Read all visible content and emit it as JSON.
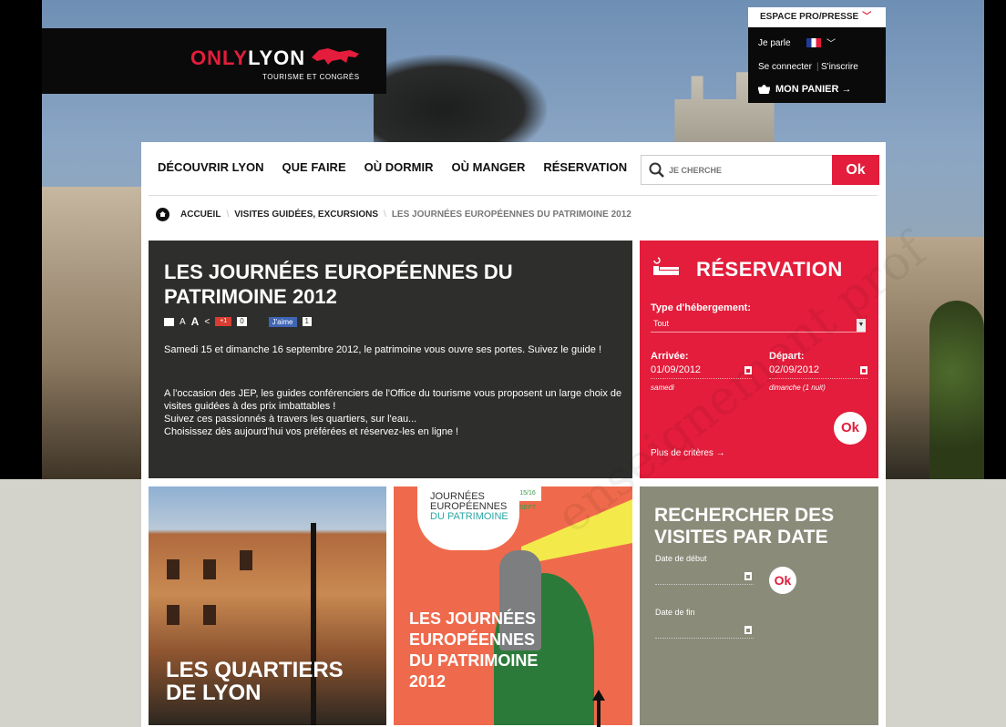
{
  "header": {
    "logo_brand_light": "ONLY",
    "logo_brand_bold": "LYON",
    "logo_tagline": "TOURISME ET CONGRÈS",
    "pro_link": "ESPACE PRO/PRESSE",
    "lang_label": "Je parle",
    "login": "Se connecter",
    "signup": "S'inscrire",
    "cart": "MON PANIER →"
  },
  "nav": {
    "items": [
      "DÉCOUVRIR LYON",
      "QUE FAIRE",
      "OÙ DORMIR",
      "OÙ MANGER",
      "RÉSERVATION"
    ],
    "search_placeholder": "JE CHERCHE",
    "search_button": "Ok"
  },
  "breadcrumb": {
    "home": "ACCUEIL",
    "section": "VISITES GUIDÉES, EXCURSIONS",
    "current": "LES JOURNÉES EUROPÉENNES DU PATRIMOINE 2012"
  },
  "article": {
    "title": "LES JOURNÉES EUROPÉENNES DU PATRIMOINE 2012",
    "text_size_small": "A",
    "text_size_large": "A",
    "gplus_label": "+1",
    "gplus_count": "0",
    "fb_like": "J'aime",
    "fb_count": "1",
    "paragraph_1": "Samedi 15 et dimanche 16 septembre 2012, le patrimoine vous ouvre ses portes. Suivez le guide !",
    "paragraph_2_lines": [
      "A l'occasion des JEP, les guides conférenciers de l'Office du tourisme vous proposent un large choix de visites guidées à des prix imbattables !",
      "Suivez ces passionnés à travers les quartiers, sur l'eau...",
      "Choisissez dès aujourd'hui vos préférées et réservez-les en ligne !"
    ]
  },
  "reservation": {
    "title": "RÉSERVATION",
    "type_label": "Type d'hébergement:",
    "type_value": "Tout",
    "arrival_label": "Arrivée:",
    "arrival_value": "01/09/2012",
    "arrival_day": "samedi",
    "departure_label": "Départ:",
    "departure_value": "02/09/2012",
    "departure_day": "dimanche (1 nuit)",
    "ok": "Ok",
    "more": "Plus de critères →"
  },
  "tiles": {
    "quarters_caption_1": "LES QUARTIERS",
    "quarters_caption_2": "DE LYON",
    "poster_line_1": "JOURNÉES",
    "poster_line_2": "EUROPÉENNES",
    "poster_line_3": "DU PATRIMOINE",
    "poster_badge": "15/16 SEPT",
    "jep_caption_1": "LES JOURNÉES",
    "jep_caption_2": "EUROPÉENNES",
    "jep_caption_3": "DU PATRIMOINE",
    "jep_caption_4": "2012",
    "visits_title_1": "RECHERCHER DES",
    "visits_title_2": "VISITES PAR DATE",
    "start_label": "Date de début",
    "end_label": "Date de fin",
    "ok": "Ok"
  },
  "watermark": "enseignement prof",
  "colors": {
    "brand_red": "#e31d3b",
    "dark_card": "#2e2f2c",
    "gray_card": "#8a8b79"
  }
}
